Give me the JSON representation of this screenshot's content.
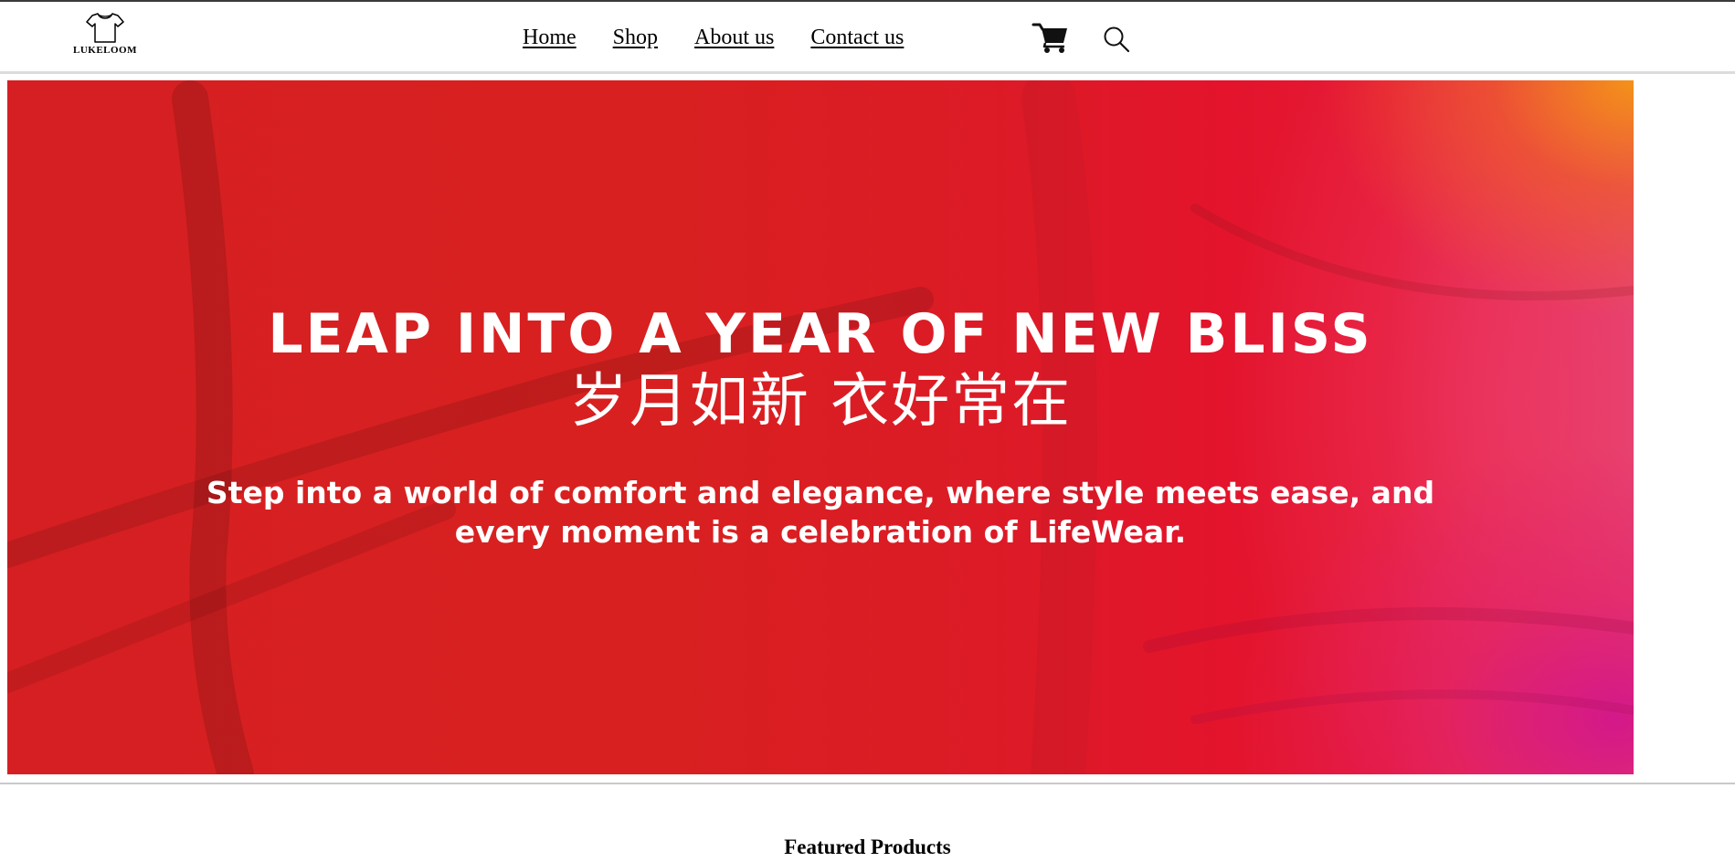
{
  "brand": {
    "name": "LUKELOOM",
    "logo_icon": "t-shirt-icon"
  },
  "nav": {
    "items": [
      {
        "label": "Home"
      },
      {
        "label": "Shop"
      },
      {
        "label": "About us"
      },
      {
        "label": "Contact us"
      }
    ],
    "cart_icon": "cart-icon",
    "search_icon": "search-icon"
  },
  "hero": {
    "title": "LEAP INTO A YEAR OF NEW BLISS",
    "subtitle_cn": "岁月如新 衣好常在",
    "tagline": "Step into a world of comfort and elegance, where style meets ease, and every moment is a celebration of LifeWear.",
    "colors": {
      "primary_red": "#d61f22",
      "accent_orange": "#f59614",
      "accent_magenta": "#d2148c"
    }
  },
  "featured": {
    "title": "Featured Products"
  }
}
